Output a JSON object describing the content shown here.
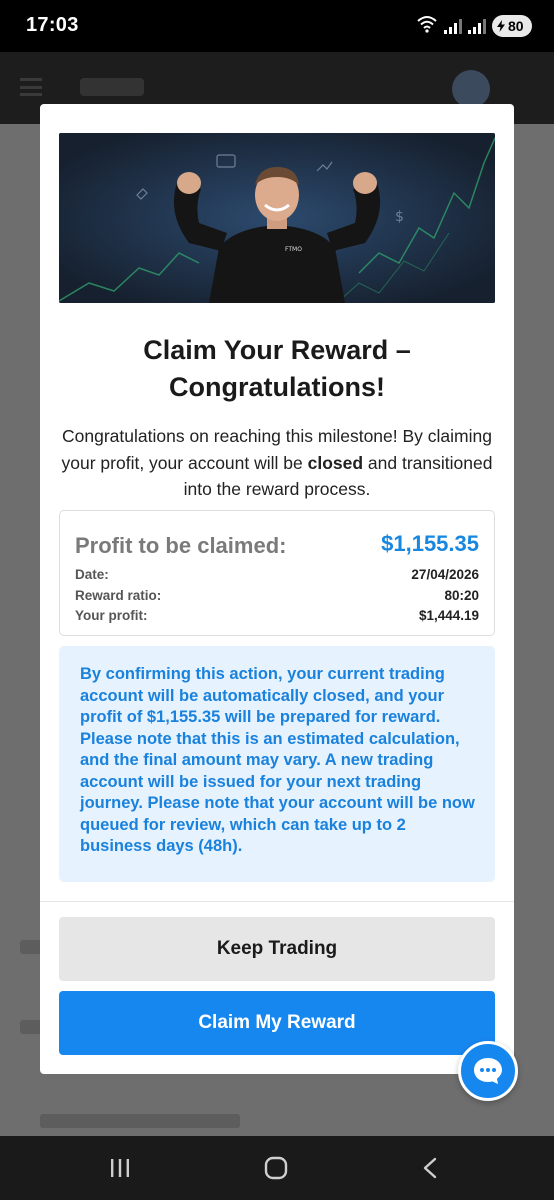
{
  "status_bar": {
    "time": "17:03",
    "battery": "80",
    "icons": [
      "wifi-icon",
      "signal-icon",
      "signal-icon",
      "battery-icon"
    ]
  },
  "modal": {
    "hero_logo_text": "FTMO",
    "title": "Claim Your Reward – Congratulations!",
    "description": {
      "before_bold": "Congratulations on reaching this milestone! By claiming your profit, your account will be ",
      "bold": "closed",
      "after_bold": " and transitioned into the reward process."
    },
    "profit": {
      "label": "Profit to be claimed:",
      "value": "$1,155.35",
      "rows": [
        {
          "label": "Date:",
          "value": "27/04/2026"
        },
        {
          "label": "Reward ratio:",
          "value": "80:20"
        },
        {
          "label": "Your profit:",
          "value": "$1,444.19"
        }
      ]
    },
    "notice": "By confirming this action, your current trading account will be automatically closed, and your profit of $1,155.35 will be prepared for reward. Please note that this is an estimated calculation, and the final amount may vary. A new trading account will be issued for your next trading journey. Please note that your account will be now queued for review, which can take up to 2 business days (48h).",
    "buttons": {
      "keep": "Keep Trading",
      "claim": "Claim My Reward"
    }
  },
  "colors": {
    "accent": "#1787f0",
    "notice_bg": "#e6f2fd",
    "notice_text": "#1a82dd",
    "secondary_button": "#e6e6e6"
  },
  "chat": {
    "icon": "chat-bubble-icon"
  },
  "nav_bar": {
    "icons": [
      "recent-apps-icon",
      "home-icon",
      "back-icon"
    ]
  }
}
